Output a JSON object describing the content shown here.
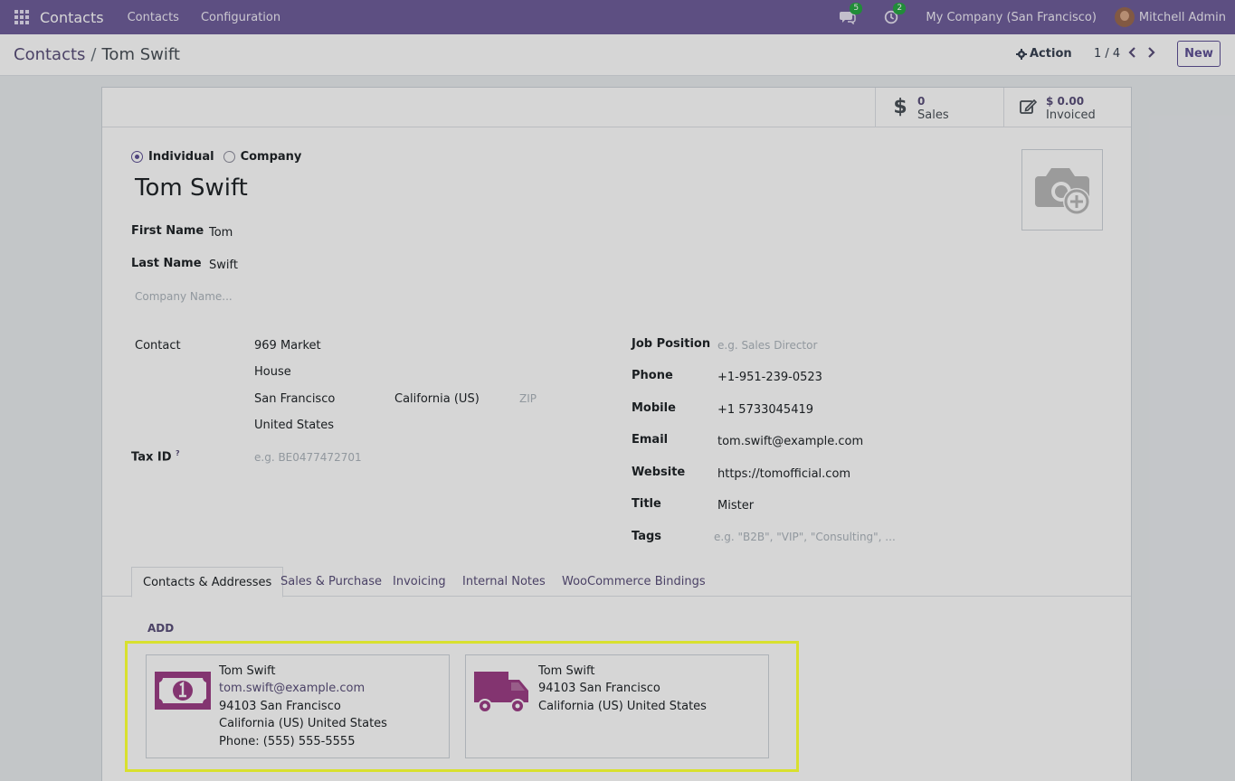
{
  "navbar": {
    "app_name": "Contacts",
    "menus": [
      "Contacts",
      "Configuration"
    ],
    "messages_count": "5",
    "activities_count": "2",
    "company": "My Company (San Francisco)",
    "user": "Mitchell Admin"
  },
  "control": {
    "breadcrumb_parent": "Contacts",
    "breadcrumb_separator": "/",
    "breadcrumb_current": "Tom Swift",
    "action_label": "Action",
    "pager": "1 / 4",
    "new_label": "New"
  },
  "stats": {
    "sales_value": "0",
    "sales_label": "Sales",
    "invoiced_value": "$ 0.00",
    "invoiced_label": "Invoiced"
  },
  "form": {
    "type_individual": "Individual",
    "type_company": "Company",
    "selected_type": "Individual",
    "name": "Tom Swift",
    "first_name_label": "First Name",
    "first_name": "Tom",
    "last_name_label": "Last Name",
    "last_name": "Swift",
    "company_name_placeholder": "Company Name...",
    "contact_label": "Contact",
    "street": "969 Market",
    "street2": "House",
    "city": "San Francisco",
    "state": "California (US)",
    "zip_placeholder": "ZIP",
    "country": "United States",
    "tax_id_label": "Tax ID",
    "tax_id_help": "?",
    "tax_id_placeholder": "e.g. BE0477472701",
    "job_position_label": "Job Position",
    "job_position_placeholder": "e.g. Sales Director",
    "phone_label": "Phone",
    "phone": "+1-951-239-0523",
    "mobile_label": "Mobile",
    "mobile": "+1 5733045419",
    "email_label": "Email",
    "email": "tom.swift@example.com",
    "website_label": "Website",
    "website": "https://tomofficial.com",
    "title_label": "Title",
    "title": "Mister",
    "tags_label": "Tags",
    "tags_placeholder": "e.g. \"B2B\", \"VIP\", \"Consulting\", ..."
  },
  "tabs": [
    "Contacts & Addresses",
    "Sales & Purchase",
    "Invoicing",
    "Internal Notes",
    "WooCommerce Bindings"
  ],
  "active_tab": "Contacts & Addresses",
  "add_label": "ADD",
  "cards": [
    {
      "icon": "invoice-money-icon",
      "color": "#9c3f86",
      "lines": [
        "Tom Swift",
        "tom.swift@example.com",
        "94103 San Francisco",
        "California (US) United States",
        "Phone: (555) 555-5555"
      ]
    },
    {
      "icon": "delivery-truck-icon",
      "color": "#9c3f86",
      "lines": [
        "Tom Swift",
        "94103 San Francisco",
        "California (US) United States"
      ]
    }
  ],
  "colors": {
    "navbar": "#6f5f9b",
    "accent": "#5f5296",
    "highlight": "#d8e02e",
    "card_icon": "#9c3f86"
  }
}
